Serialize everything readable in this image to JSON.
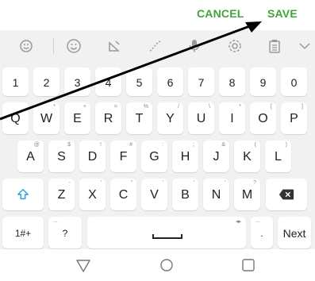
{
  "topbar": {
    "cancel_label": "CANCEL",
    "save_label": "SAVE"
  },
  "toolbar": {
    "icons": [
      "emoji-sticker-icon",
      "smiley-icon",
      "handwriting-icon",
      "brush-icon",
      "mic-icon",
      "settings-icon",
      "clipboard-icon",
      "collapse-icon"
    ]
  },
  "keyboard": {
    "number_row": [
      "1",
      "2",
      "3",
      "4",
      "5",
      "6",
      "7",
      "8",
      "9",
      "0"
    ],
    "row1": {
      "keys": [
        "Q",
        "W",
        "E",
        "R",
        "T",
        "Y",
        "U",
        "I",
        "O",
        "P"
      ],
      "subs": [
        "",
        "*",
        "+",
        "=",
        "%",
        "/",
        "\\",
        "*",
        "[",
        "]"
      ]
    },
    "row2": {
      "keys": [
        "A",
        "S",
        "D",
        "F",
        "G",
        "H",
        "J",
        "K",
        "L"
      ],
      "subs": [
        "@",
        "$",
        "!",
        "#",
        ":",
        ";",
        "&",
        "(",
        ")"
      ]
    },
    "row3": {
      "keys": [
        "Z",
        "X",
        "C",
        "V",
        "B",
        "N",
        "M"
      ],
      "subs": [
        "-",
        "'",
        "\"",
        "'",
        "'",
        "'",
        "?"
      ]
    },
    "bottom": {
      "sym_label": "1#+",
      "q_label": "?",
      "q_sub": "...",
      "period_label": ".",
      "period_sub": "...",
      "next_label": "Next"
    }
  },
  "colors": {
    "accent": "#3fa535",
    "keyboard_bg": "#f1f1f1",
    "key_bg": "#ffffff",
    "arrow": "#000000"
  }
}
